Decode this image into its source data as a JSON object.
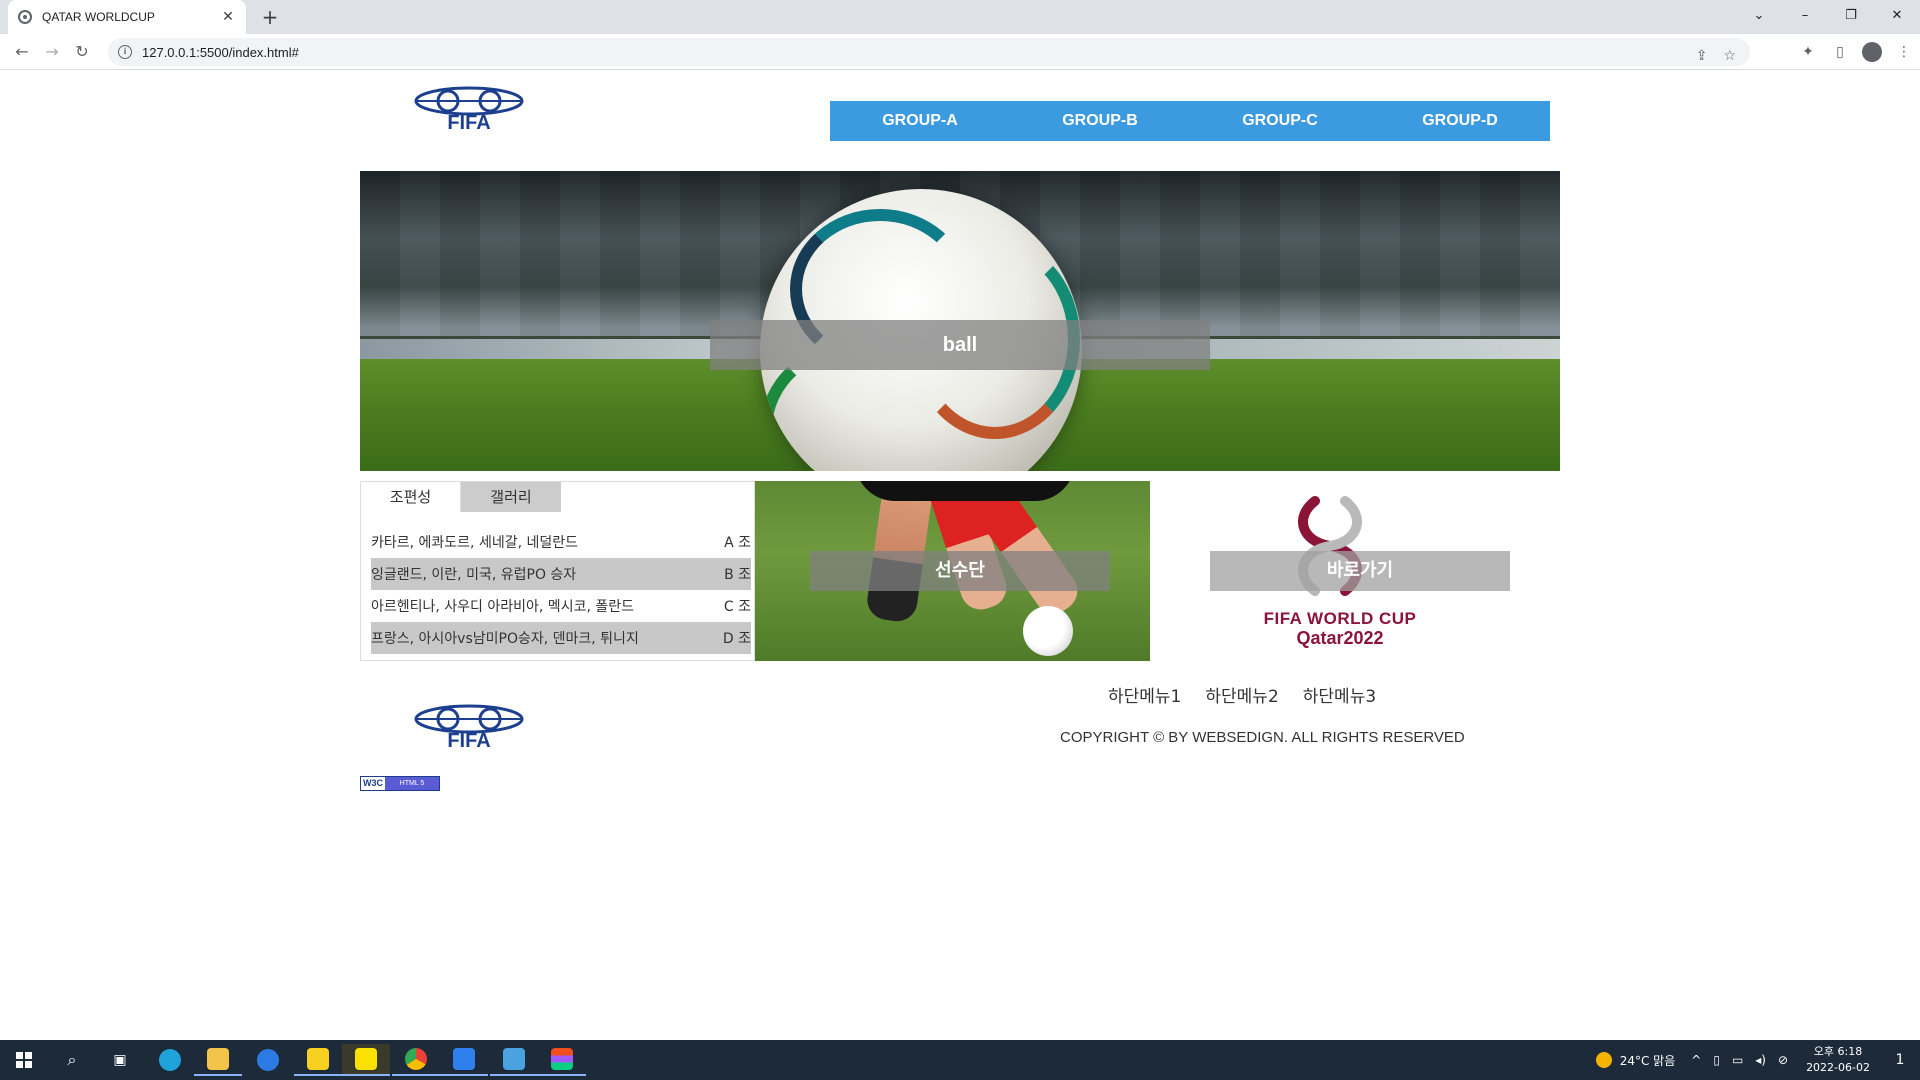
{
  "browser": {
    "tab_title": "QATAR WORLDCUP",
    "tab_close": "✕",
    "new_tab": "+",
    "url": "127.0.0.1:5500/index.html#",
    "window_controls": [
      "⌄",
      "–",
      "❐",
      "✕"
    ]
  },
  "header": {
    "nav": [
      "GROUP-A",
      "GROUP-B",
      "GROUP-C",
      "GROUP-D"
    ],
    "logo_text": "FIFA"
  },
  "hero": {
    "caption": "ball"
  },
  "tabs": {
    "labels": [
      "조편성",
      "갤러리"
    ],
    "rows": [
      {
        "teams": "카타르, 에콰도르, 세네갈, 네덜란드",
        "group": "A 조"
      },
      {
        "teams": "잉글랜드, 이란, 미국, 유럽PO 승자",
        "group": "B 조"
      },
      {
        "teams": "아르헨티나, 사우디 아라비아, 멕시코, 폴란드",
        "group": "C 조"
      },
      {
        "teams": "프랑스, 아시아vs남미PO승자, 덴마크, 튀니지",
        "group": "D 조"
      }
    ]
  },
  "players_panel": {
    "caption": "선수단"
  },
  "emblem_panel": {
    "caption": "바로가기",
    "line1": "FIFA WORLD CUP",
    "line2": "Qatar2022"
  },
  "footer": {
    "menu": [
      "하단메뉴1",
      "하단메뉴2",
      "하단메뉴3"
    ],
    "copyright": "COPYRIGHT © BY WEBSEDIGN. ALL RIGHTS RESERVED",
    "w3c_left": "W3C",
    "w3c_right": "HTML 5"
  },
  "taskbar": {
    "weather": "24°C  맑음",
    "time": "오후 6:18",
    "date": "2022-06-02",
    "notifications": "1"
  }
}
